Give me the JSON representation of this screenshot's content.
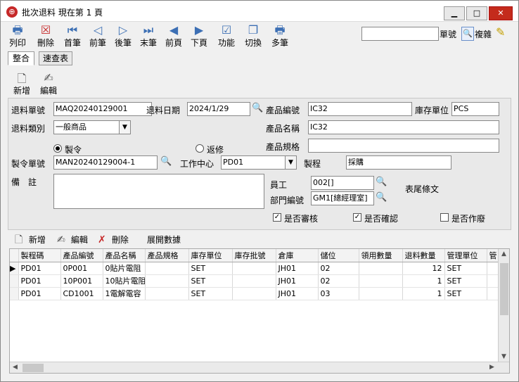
{
  "window": {
    "title": "批次退料 現在第 1 頁",
    "min_label": "▁",
    "max_label": "□",
    "close_label": "✕"
  },
  "toolbar": {
    "print": "列印",
    "delete": "刪除",
    "first": "首筆",
    "prev": "前筆",
    "next": "後筆",
    "last": "末筆",
    "prev_page": "前頁",
    "next_page": "下頁",
    "function": "功能",
    "switch": "切換",
    "multi": "多筆"
  },
  "search": {
    "value": "",
    "label": "單號",
    "complex": "複雜"
  },
  "tabs": {
    "integrate": "整合",
    "quick": "速查表"
  },
  "subtoolbar": {
    "new": "新增",
    "edit": "編輯"
  },
  "form": {
    "return_no_label": "退料單號",
    "return_no": "MAQ20240129001",
    "return_date_label": "退料日期",
    "return_date": "2024/1/29",
    "product_code_label": "產品編號",
    "product_code": "IC32",
    "stock_unit_label": "庫存單位",
    "stock_unit": "PCS",
    "return_type_label": "退料類別",
    "return_type": "一般商品",
    "product_name_label": "產品名稱",
    "product_name": "IC32",
    "product_spec_label": "產品規格",
    "product_spec": "",
    "radio_make": "製令",
    "radio_rework": "返修",
    "order_no_label": "製令單號",
    "order_no": "MAN20240129004-1",
    "work_center_label": "工作中心",
    "work_center": "PD01",
    "process_label": "製程",
    "process": "採購",
    "note_label": "備　註",
    "note": "",
    "employee_label": "員工",
    "employee": "002[]",
    "dept_label": "部門編號",
    "dept": "GM1[總經理室]",
    "tail_barcode": "表尾條文",
    "chk_review": "是否審核",
    "chk_confirm": "是否確認",
    "chk_void": "是否作廢"
  },
  "detail_toolbar": {
    "new": "新增",
    "edit": "編輯",
    "delete": "刪除",
    "expand": "展開數據"
  },
  "grid": {
    "columns": [
      "製程碼",
      "產品編號",
      "產品名稱",
      "產品規格",
      "庫存單位",
      "庫存批號",
      "倉庫",
      "儲位",
      "領用數量",
      "退料數量",
      "管理單位",
      "管"
    ],
    "rows": [
      [
        "PD01",
        "0P001",
        "0貼片電阻",
        "",
        "SET",
        "",
        "JH01",
        "02",
        "",
        "12",
        "SET",
        ""
      ],
      [
        "PD01",
        "10P001",
        "10貼片電阻",
        "",
        "SET",
        "",
        "JH01",
        "02",
        "",
        "1",
        "SET",
        ""
      ],
      [
        "PD01",
        "CD1001",
        "1電解電容",
        "",
        "SET",
        "",
        "JH01",
        "03",
        "",
        "1",
        "SET",
        ""
      ]
    ]
  }
}
